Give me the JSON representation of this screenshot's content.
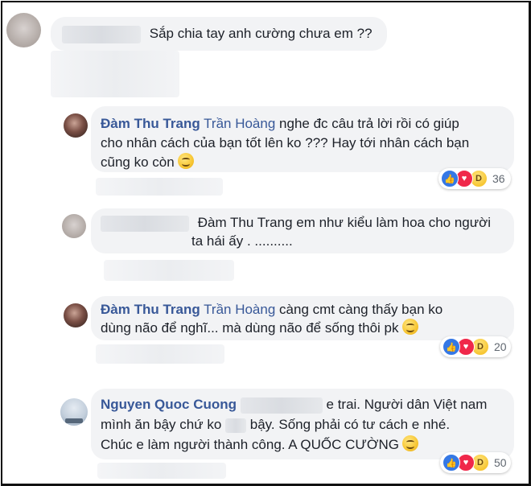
{
  "comments": [
    {
      "author": "",
      "text": "Sắp chia tay anh cường chưa em ??"
    },
    {
      "author": "Đàm Thu Trang",
      "mention": "Trần Hoàng",
      "text_line1": "nghe đc câu trả lời rồi có giúp",
      "text_line2": "cho nhân cách của bạn tốt lên ko ??? Hay tới nhân cách bạn",
      "text_line3": "cũng ko còn",
      "reaction_count": "36"
    },
    {
      "author": "",
      "text_line1": "Đàm Thu Trang em như kiểu làm hoa cho người",
      "text_line2": "ta hái ấy . .........."
    },
    {
      "author": "Đàm Thu Trang",
      "mention": "Trần Hoàng",
      "text_line1": "càng cmt càng thấy bạn ko",
      "text_line2": "dùng não để nghĩ... mà dùng não để sống thôi pk",
      "reaction_count": "20"
    },
    {
      "author": "Nguyen Quoc Cuong",
      "text_line1a": "e trai. Người dân Việt nam",
      "text_line2a": "mình ăn bậy chứ ko",
      "text_line2b": "bậy. Sống phải có tư cách e nhé.",
      "text_line3": "Chúc e làm người thành công. A QUỐC CƯỜNG",
      "reaction_count": "50"
    }
  ],
  "icons": {
    "like": "like-icon",
    "love": "love-icon",
    "haha": "haha-icon",
    "smile": "smiley-emoji"
  },
  "colors": {
    "bubble": "#f2f3f5",
    "name": "#385898",
    "text": "#1d2129",
    "like": "#3578e5",
    "love": "#f0284a"
  }
}
